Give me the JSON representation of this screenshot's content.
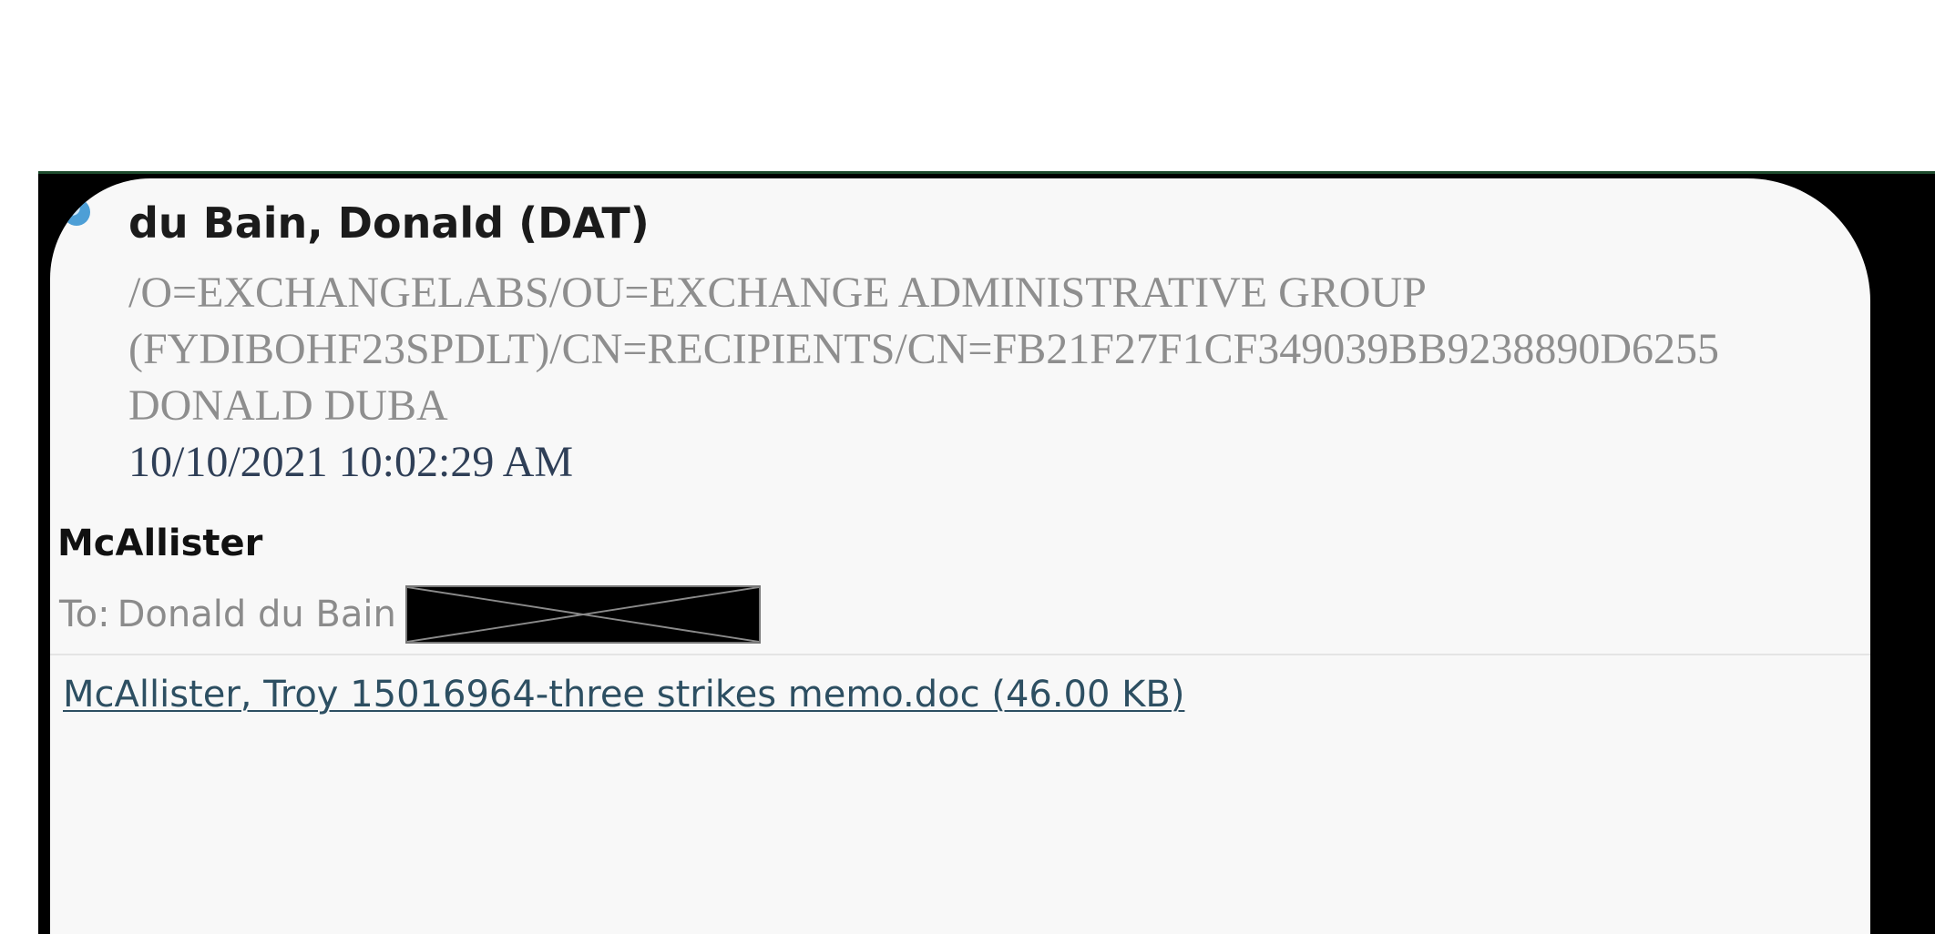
{
  "email": {
    "sender_name": "du Bain, Donald (DAT)",
    "sender_address_line_1": "/O=EXCHANGELABS/OU=EXCHANGE ADMINISTRATIVE GROUP",
    "sender_address_line_2": "(FYDIBOHF23SPDLT)/CN=RECIPIENTS/CN=FB21F27F1CF349039BB9238890D6255",
    "sender_display_name": "DONALD DUBA",
    "sent_time": "10/10/2021 10:02:29 AM",
    "subject": "McAllister",
    "to_label": "To:",
    "to_name": "Donald du Bain",
    "attachment": "McAllister, Troy 15016964-three strikes memo.doc (46.00 KB)"
  },
  "icons": {
    "sender_avatar": "avatar-icon",
    "redaction": "redaction-box"
  },
  "colors": {
    "panel_background": "#f8f8f8",
    "outer_frame": "#000000",
    "frame_top_border": "#1d4a2c",
    "avatar_accent": "#4d9fd6",
    "muted_text": "#8e8e8e",
    "link_text": "#2d4f62"
  }
}
